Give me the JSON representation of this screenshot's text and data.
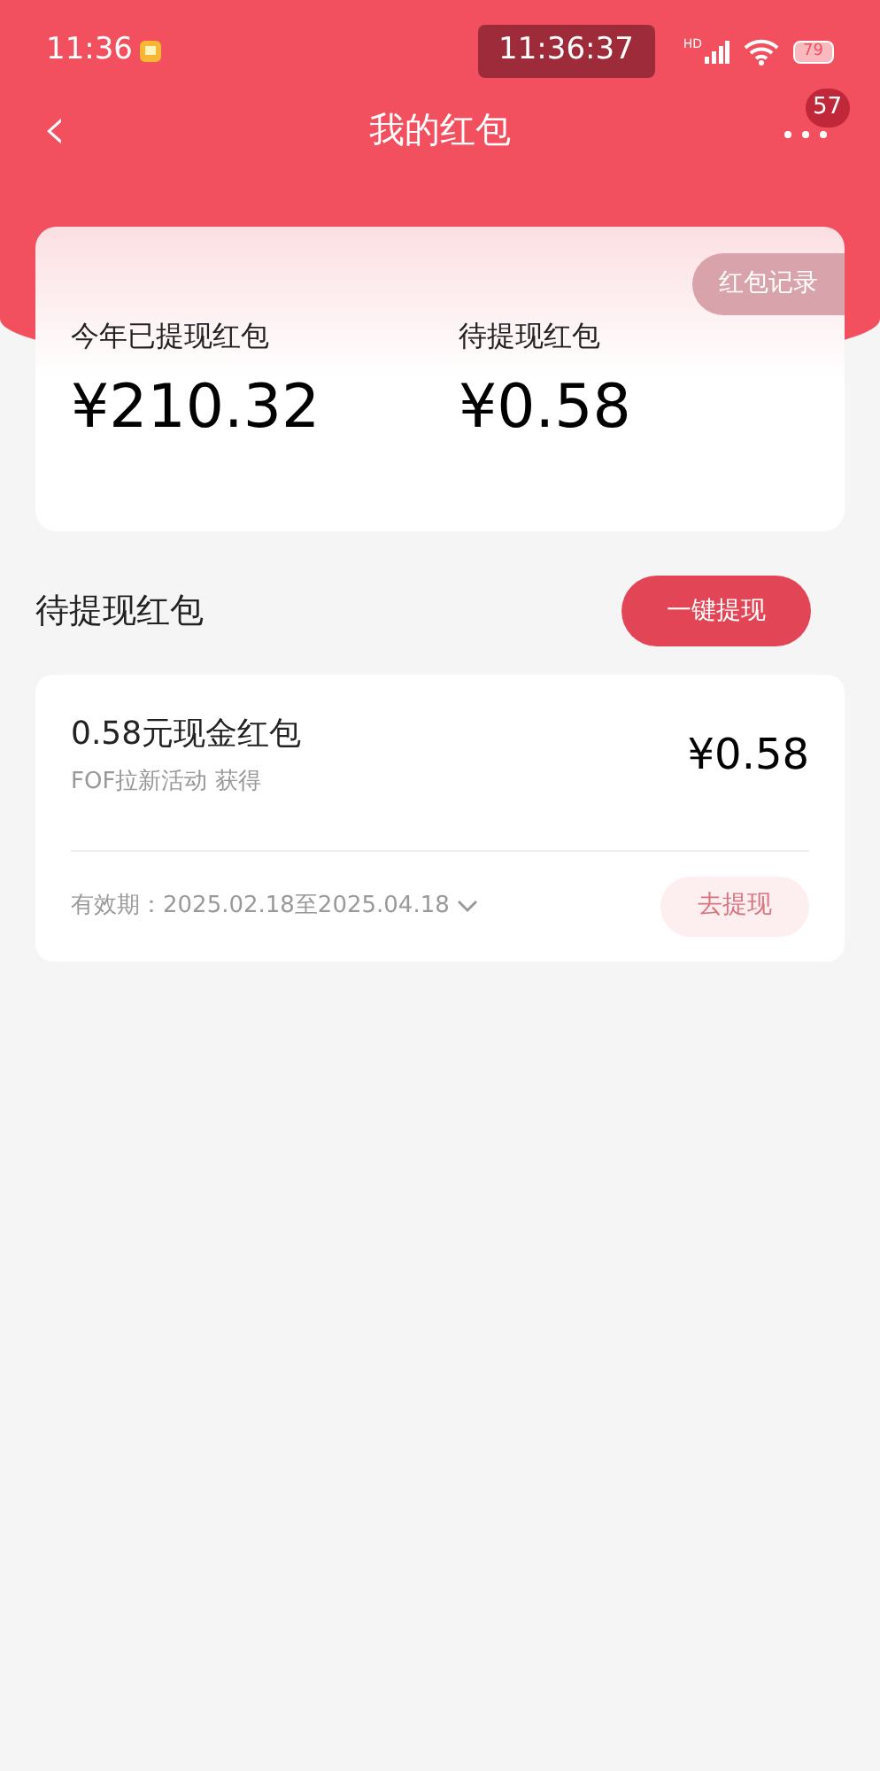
{
  "status_bar": {
    "time": "11:36",
    "clock": "11:36:37",
    "network": "HD",
    "battery": "79"
  },
  "nav": {
    "back": "‹",
    "title": "我的红包",
    "badge": "57"
  },
  "summary": {
    "record_button": "红包记录",
    "stats": [
      {
        "label": "今年已提现红包",
        "amount": "¥210.32"
      },
      {
        "label": "待提现红包",
        "amount": "¥0.58"
      }
    ]
  },
  "pending": {
    "title": "待提现红包",
    "action": "一键提现"
  },
  "packets": [
    {
      "title": "0.58元现金红包",
      "source": "FOF拉新活动 获得",
      "amount": "¥0.58",
      "validity": "有效期：2025.02.18至2025.04.18",
      "button": "去提现"
    }
  ]
}
